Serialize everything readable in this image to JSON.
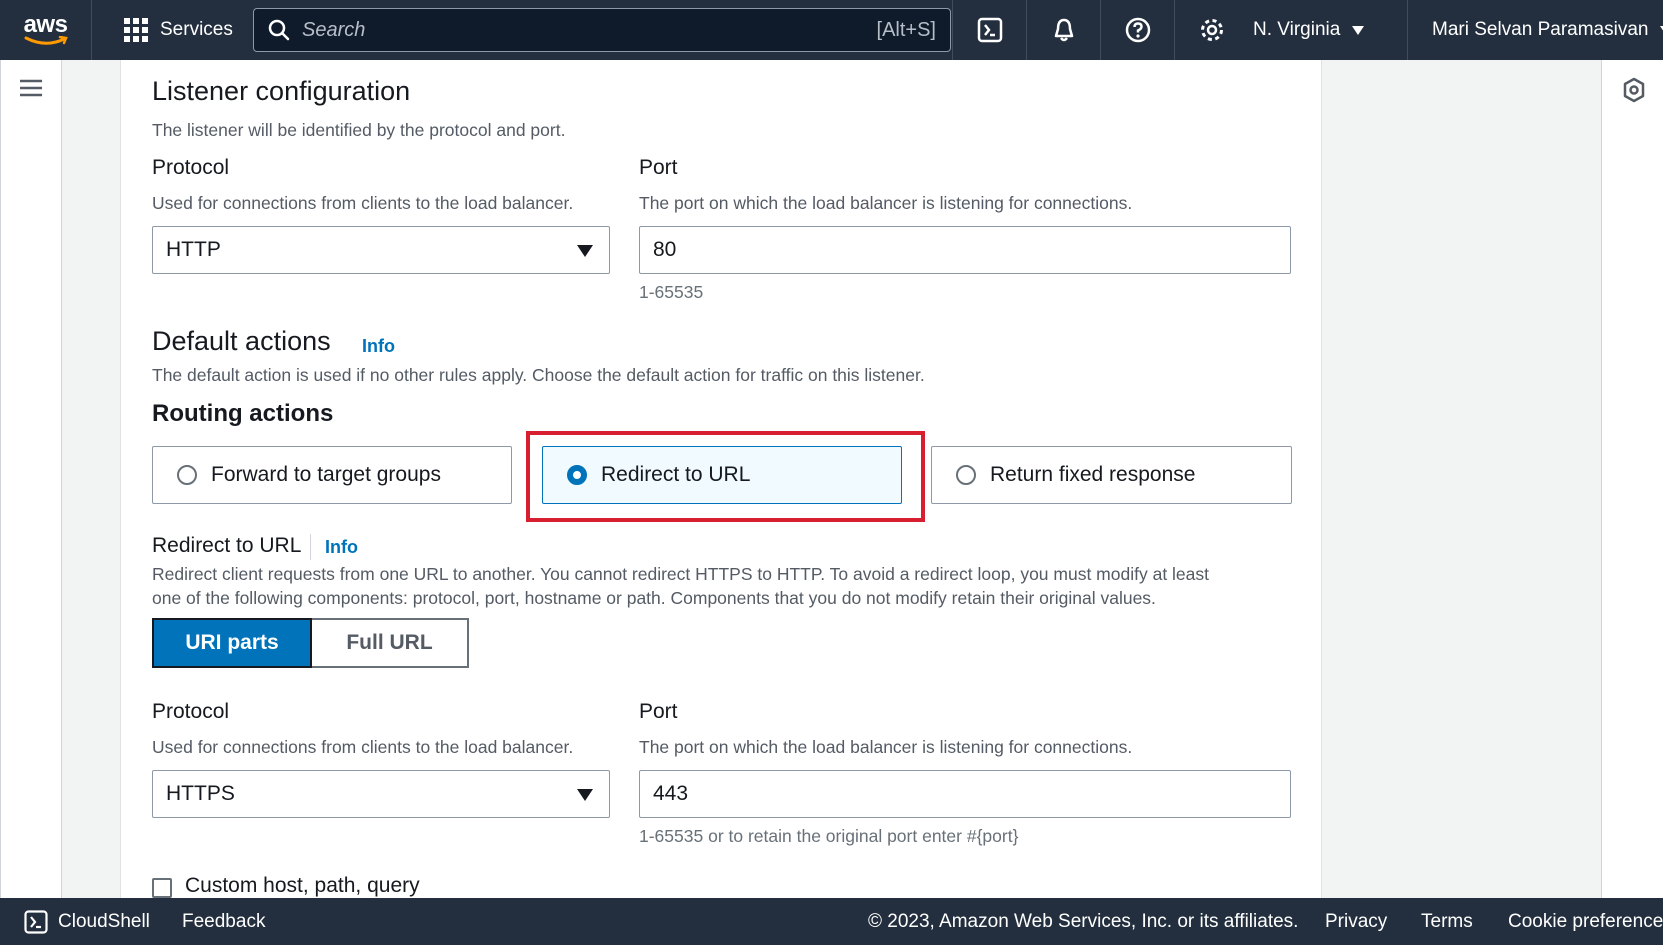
{
  "nav": {
    "logo_text": "aws",
    "services_label": "Services",
    "search_placeholder": "Search",
    "search_shortcut": "[Alt+S]",
    "region": "N. Virginia",
    "user": "Mari Selvan Paramasivan"
  },
  "listener": {
    "title": "Listener configuration",
    "description": "The listener will be identified by the protocol and port.",
    "protocol_label": "Protocol",
    "protocol_desc": "Used for connections from clients to the load balancer.",
    "protocol_value": "HTTP",
    "port_label": "Port",
    "port_desc": "The port on which the load balancer is listening for connections.",
    "port_value": "80",
    "port_hint": "1-65535"
  },
  "default_actions": {
    "title": "Default actions",
    "info": "Info",
    "description": "The default action is used if no other rules apply. Choose the default action for traffic on this listener.",
    "routing_title": "Routing actions",
    "options": [
      {
        "label": "Forward to target groups",
        "selected": false
      },
      {
        "label": "Redirect to URL",
        "selected": true
      },
      {
        "label": "Return fixed response",
        "selected": false
      }
    ]
  },
  "redirect": {
    "title": "Redirect to URL",
    "info": "Info",
    "desc_line1": "Redirect client requests from one URL to another. You cannot redirect HTTPS to HTTP. To avoid a redirect loop, you must modify at least",
    "desc_line2": "one of the following components: protocol, port, hostname or path. Components that you do not modify retain their original values.",
    "segments": [
      "URI parts",
      "Full URL"
    ],
    "protocol_label": "Protocol",
    "protocol_desc": "Used for connections from clients to the load balancer.",
    "protocol_value": "HTTPS",
    "port_label": "Port",
    "port_desc": "The port on which the load balancer is listening for connections.",
    "port_value": "443",
    "port_hint": "1-65535 or to retain the original port enter #{port}",
    "custom_label": "Custom host, path, query"
  },
  "footer": {
    "cloudshell": "CloudShell",
    "feedback": "Feedback",
    "copyright": "© 2023, Amazon Web Services, Inc. or its affiliates.",
    "privacy": "Privacy",
    "terms": "Terms",
    "cookies": "Cookie preferences"
  },
  "colors": {
    "nav_bg": "#232f3e",
    "accent": "#0073bb",
    "highlight": "#d81f2f",
    "logo_smile": "#ff9900"
  }
}
